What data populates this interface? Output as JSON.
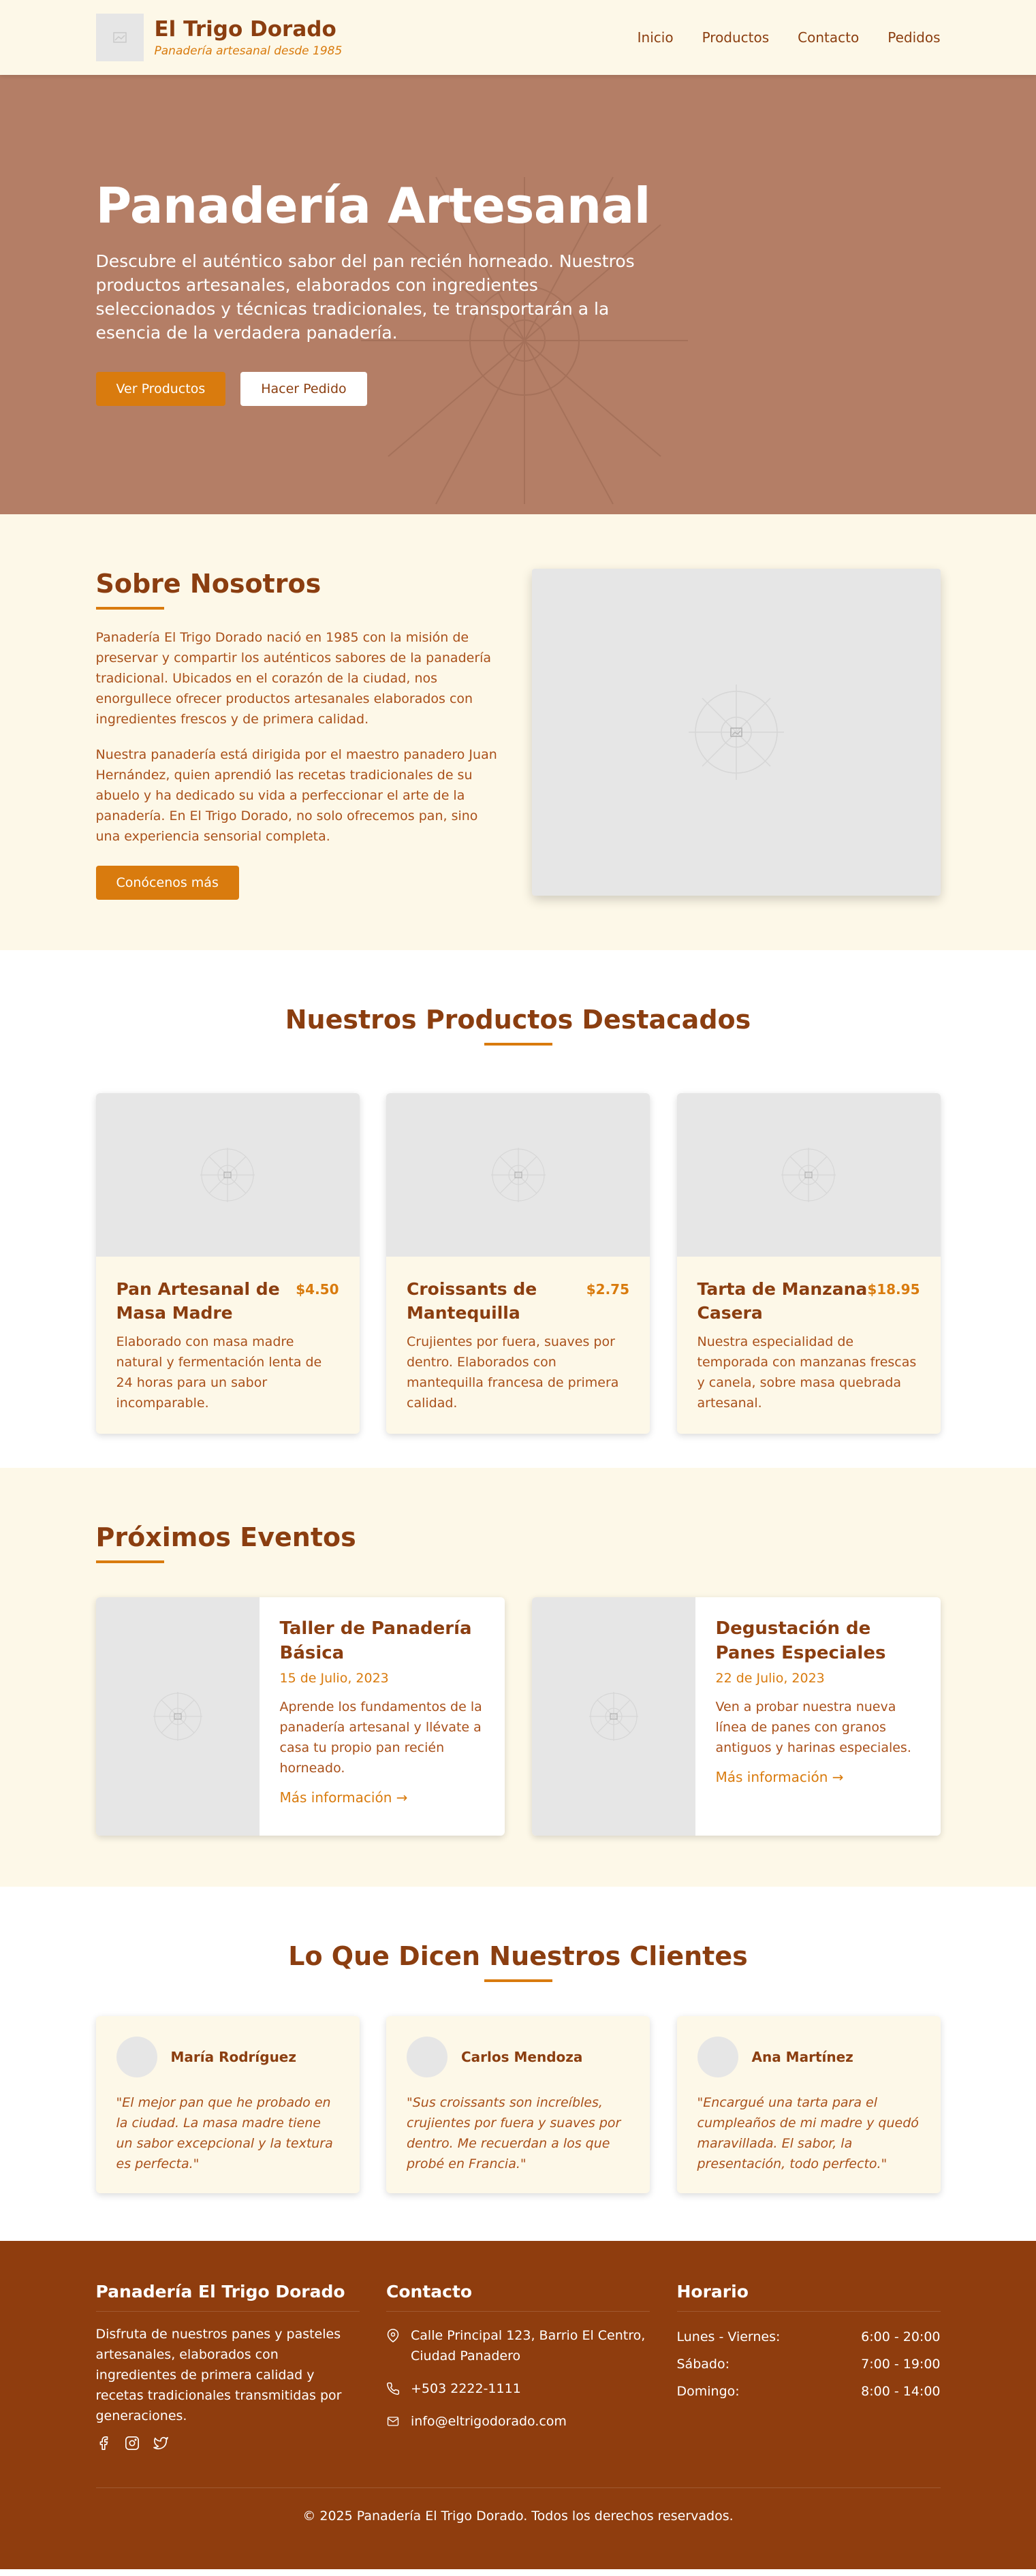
{
  "colors": {
    "brand_brown": "#8b3e10",
    "accent_orange": "#d97b0e",
    "cream": "#fdf8e8",
    "hero_bg": "#b47e66",
    "footer_bg": "#8f3d0e",
    "placeholder": "#e6e6e6"
  },
  "header": {
    "brand_name": "El Trigo Dorado",
    "tagline": "Panadería artesanal desde 1985",
    "logo_icon": "image-placeholder-icon",
    "nav": [
      "Inicio",
      "Productos",
      "Contacto",
      "Pedidos"
    ]
  },
  "hero": {
    "title": "Panadería Artesanal",
    "description": "Descubre el auténtico sabor del pan recién horneado. Nuestros productos artesanales, elaborados con ingredientes seleccionados y técnicas tradicionales, te transportarán a la esencia de la verdadera panadería.",
    "primary_button": "Ver Productos",
    "secondary_button": "Hacer Pedido"
  },
  "about": {
    "title": "Sobre Nosotros",
    "paragraph1": "Panadería El Trigo Dorado nació en 1985 con la misión de preservar y compartir los auténticos sabores de la panadería tradicional. Ubicados en el corazón de la ciudad, nos enorgullece ofrecer productos artesanales elaborados con ingredientes frescos y de primera calidad.",
    "paragraph2": "Nuestra panadería está dirigida por el maestro panadero Juan Hernández, quien aprendió las recetas tradicionales de su abuelo y ha dedicado su vida a perfeccionar el arte de la panadería. En El Trigo Dorado, no solo ofrecemos pan, sino una experiencia sensorial completa.",
    "button": "Conócenos más"
  },
  "products": {
    "title": "Nuestros Productos Destacados",
    "items": [
      {
        "name": "Pan Artesanal de Masa Madre",
        "price": "$4.50",
        "description": "Elaborado con masa madre natural y fermentación lenta de 24 horas para un sabor incomparable."
      },
      {
        "name": "Croissants de Mantequilla",
        "price": "$2.75",
        "description": "Crujientes por fuera, suaves por dentro. Elaborados con mantequilla francesa de primera calidad."
      },
      {
        "name": "Tarta de Manzana Casera",
        "price": "$18.95",
        "description": "Nuestra especialidad de temporada con manzanas frescas y canela, sobre masa quebrada artesanal."
      }
    ]
  },
  "events": {
    "title": "Próximos Eventos",
    "items": [
      {
        "title": "Taller de Panadería Básica",
        "date": "15 de Julio, 2023",
        "description": "Aprende los fundamentos de la panadería artesanal y llévate a casa tu propio pan recién horneado.",
        "link": "Más información →"
      },
      {
        "title": "Degustación de Panes Especiales",
        "date": "22 de Julio, 2023",
        "description": "Ven a probar nuestra nueva línea de panes con granos antiguos y harinas especiales.",
        "link": "Más información →"
      }
    ]
  },
  "testimonials": {
    "title": "Lo Que Dicen Nuestros Clientes",
    "items": [
      {
        "name": "María Rodríguez",
        "quote": "\"El mejor pan que he probado en la ciudad. La masa madre tiene un sabor excepcional y la textura es perfecta.\""
      },
      {
        "name": "Carlos Mendoza",
        "quote": "\"Sus croissants son increíbles, crujientes por fuera y suaves por dentro. Me recuerdan a los que probé en Francia.\""
      },
      {
        "name": "Ana Martínez",
        "quote": "\"Encargué una tarta para el cumpleaños de mi madre y quedó maravillada. El sabor, la presentación, todo perfecto.\""
      }
    ]
  },
  "footer": {
    "col1_title": "Panadería El Trigo Dorado",
    "col1_text": "Disfruta de nuestros panes y pasteles artesanales, elaborados con ingredientes de primera calidad y recetas tradicionales transmitidas por generaciones.",
    "social_icons": [
      "facebook-icon",
      "instagram-icon",
      "twitter-icon"
    ],
    "col2_title": "Contacto",
    "address": "Calle Principal 123, Barrio El Centro, Ciudad Panadero",
    "phone": "+503 2222-1111",
    "email": "info@eltrigodorado.com",
    "col3_title": "Horario",
    "hours": [
      {
        "day": "Lunes - Viernes:",
        "time": "6:00 - 20:00"
      },
      {
        "day": "Sábado:",
        "time": "7:00 - 19:00"
      },
      {
        "day": "Domingo:",
        "time": "8:00 - 14:00"
      }
    ],
    "copyright": "© 2025 Panadería El Trigo Dorado. Todos los derechos reservados."
  }
}
